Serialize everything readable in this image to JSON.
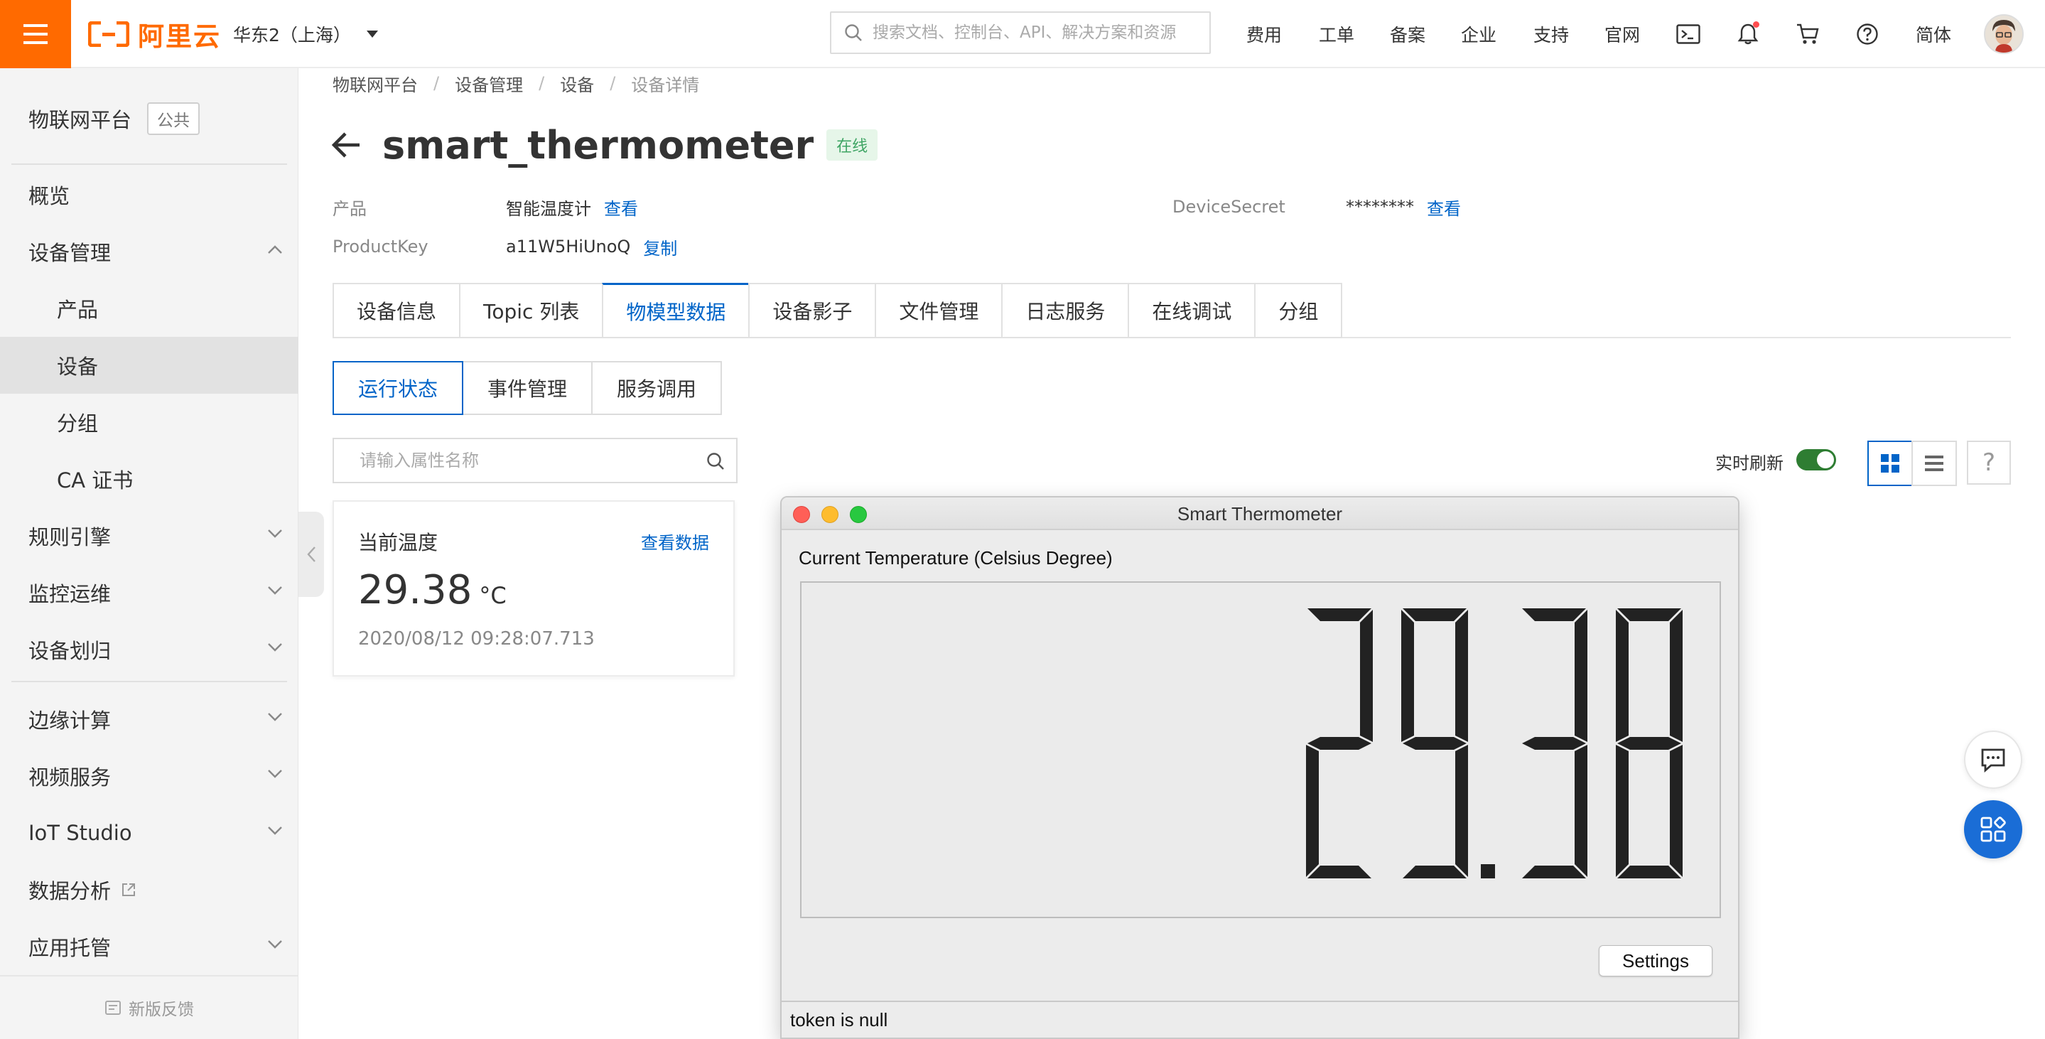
{
  "topbar": {
    "brand": "阿里云",
    "region": "华东2（上海）",
    "search_placeholder": "搜索文档、控制台、API、解决方案和资源",
    "nav": [
      "费用",
      "工单",
      "备案",
      "企业",
      "支持",
      "官网"
    ],
    "language": "简体",
    "notification_dot_color": "#ff4d4f"
  },
  "sidebar": {
    "title": "物联网平台",
    "badge": "公共",
    "items": [
      {
        "label": "概览"
      },
      {
        "label": "设备管理"
      },
      {
        "label": "产品"
      },
      {
        "label": "设备"
      },
      {
        "label": "分组"
      },
      {
        "label": "CA 证书"
      },
      {
        "label": "规则引擎"
      },
      {
        "label": "监控运维"
      },
      {
        "label": "设备划归"
      },
      {
        "label": "边缘计算"
      },
      {
        "label": "视频服务"
      },
      {
        "label": "IoT Studio"
      },
      {
        "label": "数据分析"
      },
      {
        "label": "应用托管"
      }
    ],
    "feedback": "新版反馈"
  },
  "breadcrumb": [
    "物联网平台",
    "设备管理",
    "设备",
    "设备详情"
  ],
  "device": {
    "name": "smart_thermometer",
    "status": "在线",
    "product_label": "产品",
    "product_value": "智能温度计",
    "product_link": "查看",
    "productkey_label": "ProductKey",
    "productkey_value": "a11W5HiUnoQ",
    "productkey_link": "复制",
    "secret_label": "DeviceSecret",
    "secret_value": "********",
    "secret_link": "查看"
  },
  "tabs": [
    "设备信息",
    "Topic 列表",
    "物模型数据",
    "设备影子",
    "文件管理",
    "日志服务",
    "在线调试",
    "分组"
  ],
  "subtabs": [
    "运行状态",
    "事件管理",
    "服务调用"
  ],
  "property_search_placeholder": "请输入属性名称",
  "realtime_label": "实时刷新",
  "realtime_on": true,
  "help_label": "?",
  "card": {
    "title": "当前温度",
    "link": "查看数据",
    "value": "29.38",
    "unit": "°C",
    "time": "2020/08/12 09:28:07.713"
  },
  "mac_window": {
    "title": "Smart Thermometer",
    "label": "Current Temperature (Celsius Degree)",
    "display_value": "29.38",
    "settings": "Settings",
    "status": "token is null"
  },
  "colors": {
    "brand_orange": "#ff6a00",
    "link_blue": "#0064c8",
    "online_green": "#3fa564",
    "toggle_green": "#2e7d32",
    "lcd_segment": "#222222"
  }
}
